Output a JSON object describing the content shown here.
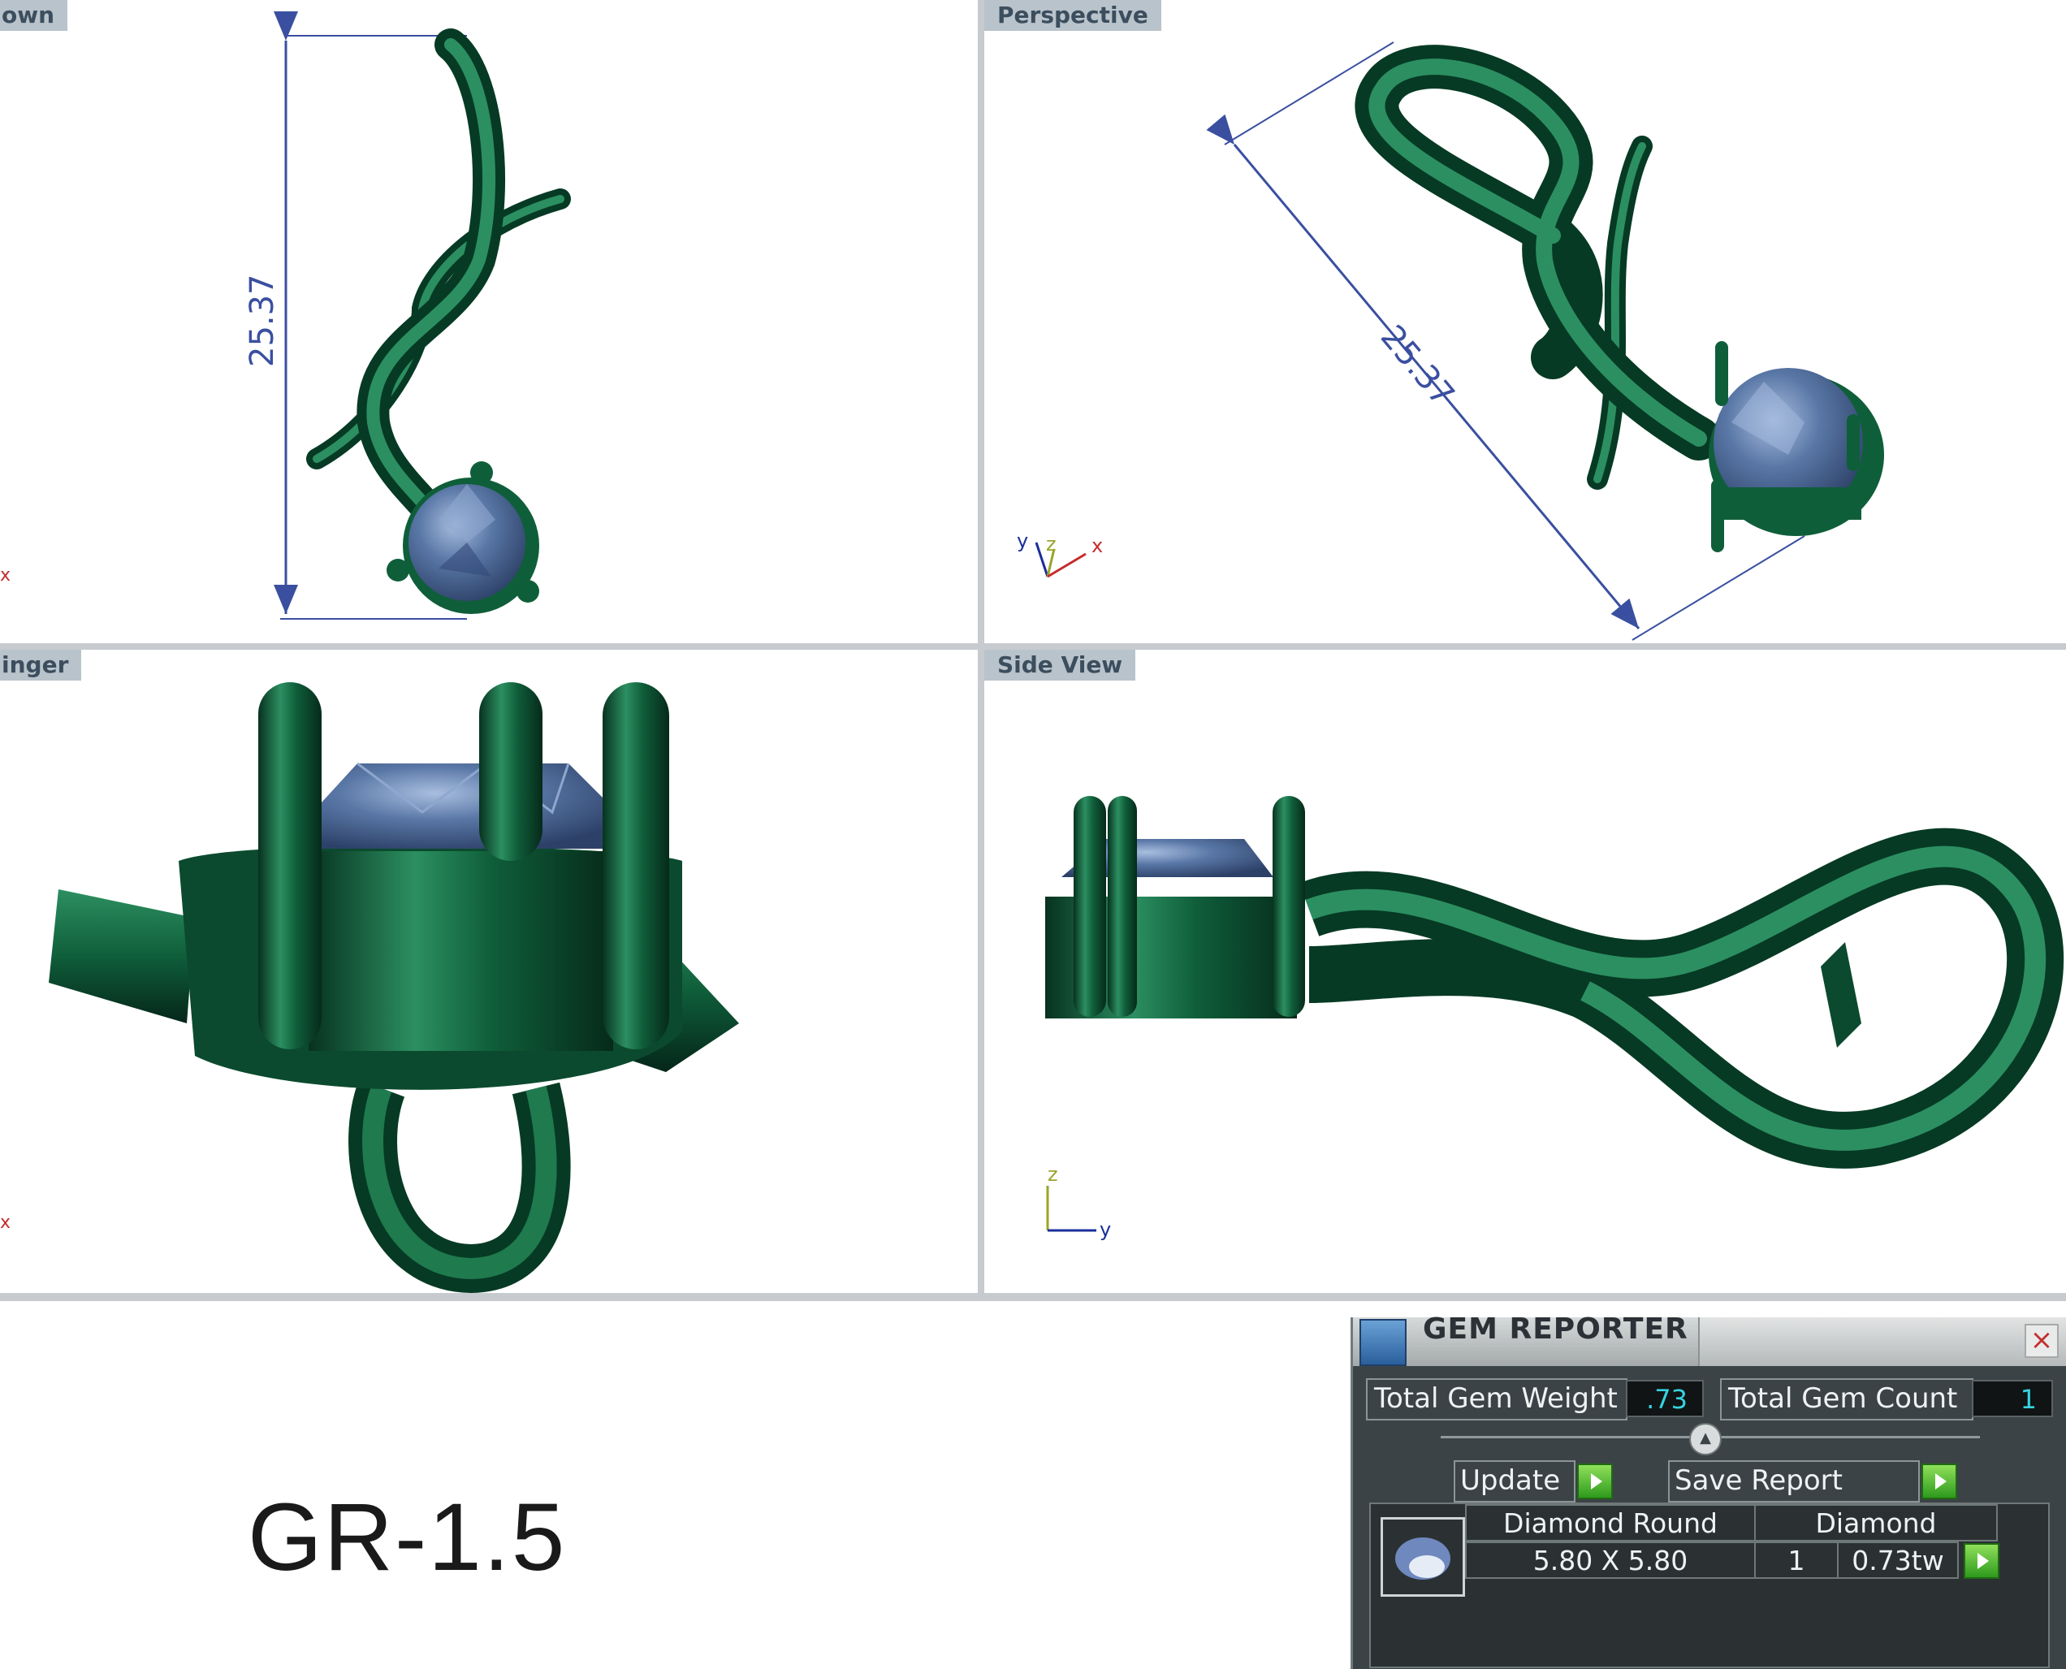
{
  "viewports": {
    "top": {
      "label": "own",
      "dimension": "25.37"
    },
    "perspective": {
      "label": "Perspective",
      "dimension": "25.37",
      "axes": {
        "y": "y",
        "z": "z",
        "x": "x"
      }
    },
    "front": {
      "label": "inger"
    },
    "side": {
      "label": "Side View",
      "axes": {
        "z": "z",
        "y": "y"
      }
    }
  },
  "part_number": "GR-1.5",
  "gem_reporter": {
    "title": "GEM REPORTER",
    "close": "×",
    "total_gem_weight_label": "Total Gem Weight",
    "total_gem_weight_value": ".73",
    "total_gem_count_label": "Total Gem Count",
    "total_gem_count_value": "1",
    "update_label": "Update",
    "save_report_label": "Save Report",
    "gems": [
      {
        "shape": "Diamond Round",
        "type": "Diamond",
        "size": "5.80 X 5.80",
        "count": "1",
        "weight": "0.73tw"
      }
    ]
  },
  "colors": {
    "metal": "#0f5e3a",
    "metal_highlight": "#2f9566",
    "gem": "#5977a6",
    "dimension_line": "#3a4fa0",
    "label_bg": "#b9c3cb",
    "panel_bg": "#3b4346",
    "value_cyan": "#36d3e0",
    "play_green": "#2e9a1d"
  },
  "icons": [
    "gem-reporter-app-icon",
    "close-icon",
    "play-icon",
    "slider-knob-icon",
    "round-gem-icon"
  ]
}
